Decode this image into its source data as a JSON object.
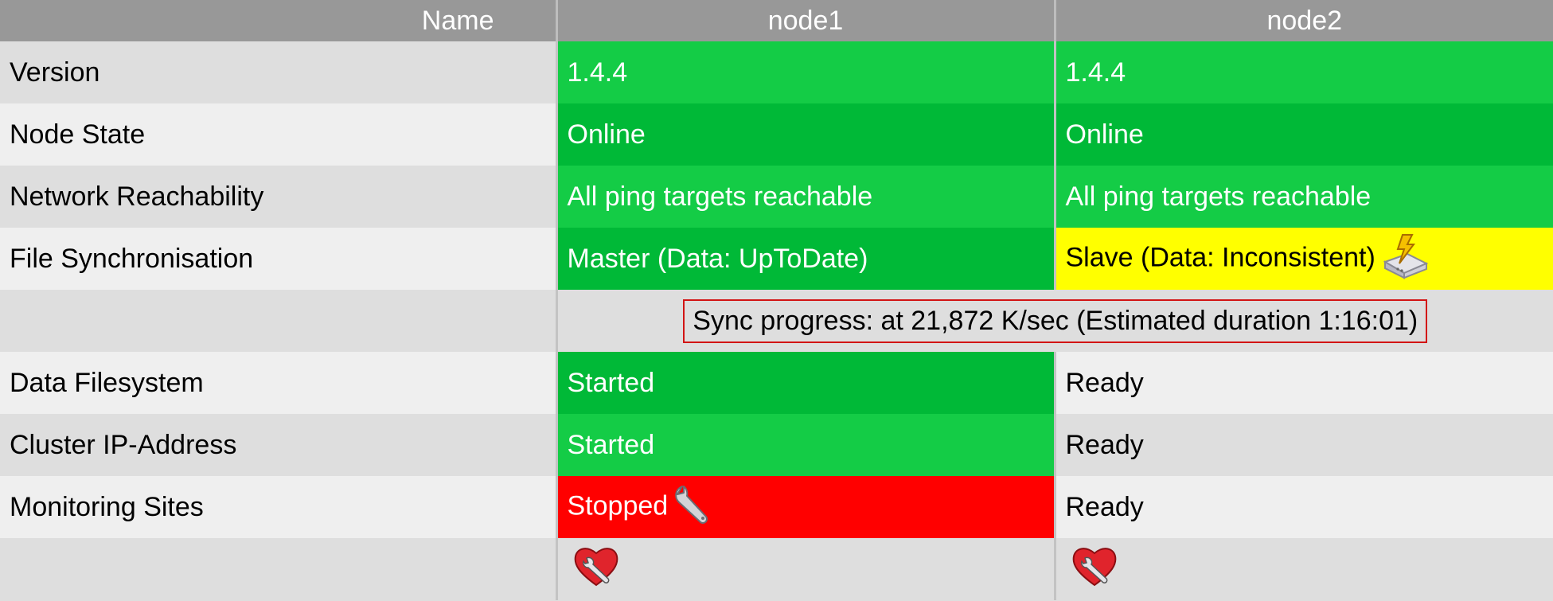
{
  "header": {
    "name": "Name",
    "node1": "node1",
    "node2": "node2"
  },
  "rows": [
    {
      "label": "Version",
      "node1": "1.4.4",
      "node2": "1.4.4"
    },
    {
      "label": "Node State",
      "node1": "Online",
      "node2": "Online"
    },
    {
      "label": "Network Reachability",
      "node1": "All ping targets reachable",
      "node2": "All ping targets reachable"
    },
    {
      "label": "File Synchronisation",
      "node1": "Master (Data: UpToDate)",
      "node2": "Slave (Data: Inconsistent)"
    },
    {
      "label": "Data Filesystem",
      "node1": "Started",
      "node2": "Ready"
    },
    {
      "label": "Cluster IP-Address",
      "node1": "Started",
      "node2": "Ready"
    },
    {
      "label": "Monitoring Sites",
      "node1": "Stopped",
      "node2": "Ready"
    }
  ],
  "sync_progress": "Sync progress: at 21,872 K/sec (Estimated duration 1:16:01)",
  "icons": {
    "sync_warning": "disk-sync-lightning-icon",
    "wrench": "wrench-icon",
    "node_action": "heart-wrench-icon"
  },
  "colors": {
    "ok_light": "#14cc46",
    "ok_dark": "#00b937",
    "warning": "#ffff00",
    "error": "#ff0000",
    "header": "#989898"
  }
}
